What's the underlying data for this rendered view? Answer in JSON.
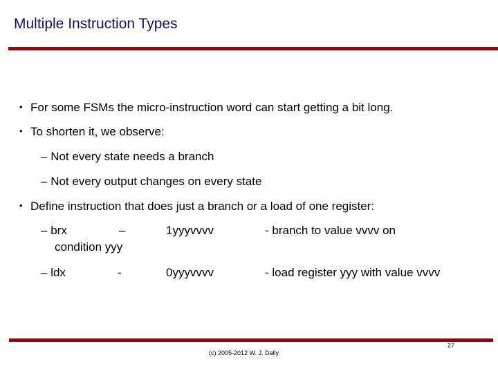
{
  "slide": {
    "title": "Multiple Instruction Types",
    "accent_color": "#8c0a0c",
    "title_color": "#10125e",
    "bullets": [
      {
        "marker": "•",
        "text": "For some FSMs the micro-instruction word can start getting a bit long."
      },
      {
        "marker": "•",
        "text": "To shorten it, we observe:",
        "subitems": [
          {
            "marker": "–",
            "text": "Not every state needs a branch"
          },
          {
            "marker": "–",
            "text": "Not every output changes on every state"
          }
        ]
      },
      {
        "marker": "•",
        "text": "Define instruction that does just a branch or a load of one register:"
      }
    ],
    "instructions": [
      {
        "marker": "–",
        "name": "brx",
        "sep": "–",
        "encoding": "1yyyvvvv",
        "description": "- branch to value vvvv on",
        "continuation": "condition yyy"
      },
      {
        "marker": "–",
        "name": "ldx",
        "sep": "-",
        "encoding": "0yyyvvvv",
        "description": "- load register yyy with value vvvv"
      }
    ],
    "footer": "(c) 2005-2012 W. J. Dally",
    "page_number": "27"
  }
}
